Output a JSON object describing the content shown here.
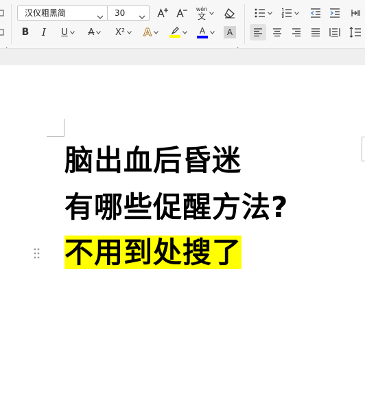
{
  "toolbar": {
    "font_name": "汉仪粗黑简",
    "font_size": "30",
    "pinyin_glyph": "wén",
    "pinyin_char": "文",
    "buttons": {
      "bold": "B",
      "italic": "I",
      "underline": "U",
      "strike": "A",
      "superscript": "X²",
      "text_effect": "A",
      "highlight": "A",
      "font_color": "A",
      "shading": "A"
    },
    "colors": {
      "highlight": "#ffff00",
      "font_color": "#0000ff",
      "active_align": "#e3e3e3"
    }
  },
  "document": {
    "lines": [
      "脑出血后昏迷",
      "有哪些促醒方法?",
      "不用到处搜了"
    ],
    "highlight_color": "#ffff00"
  }
}
